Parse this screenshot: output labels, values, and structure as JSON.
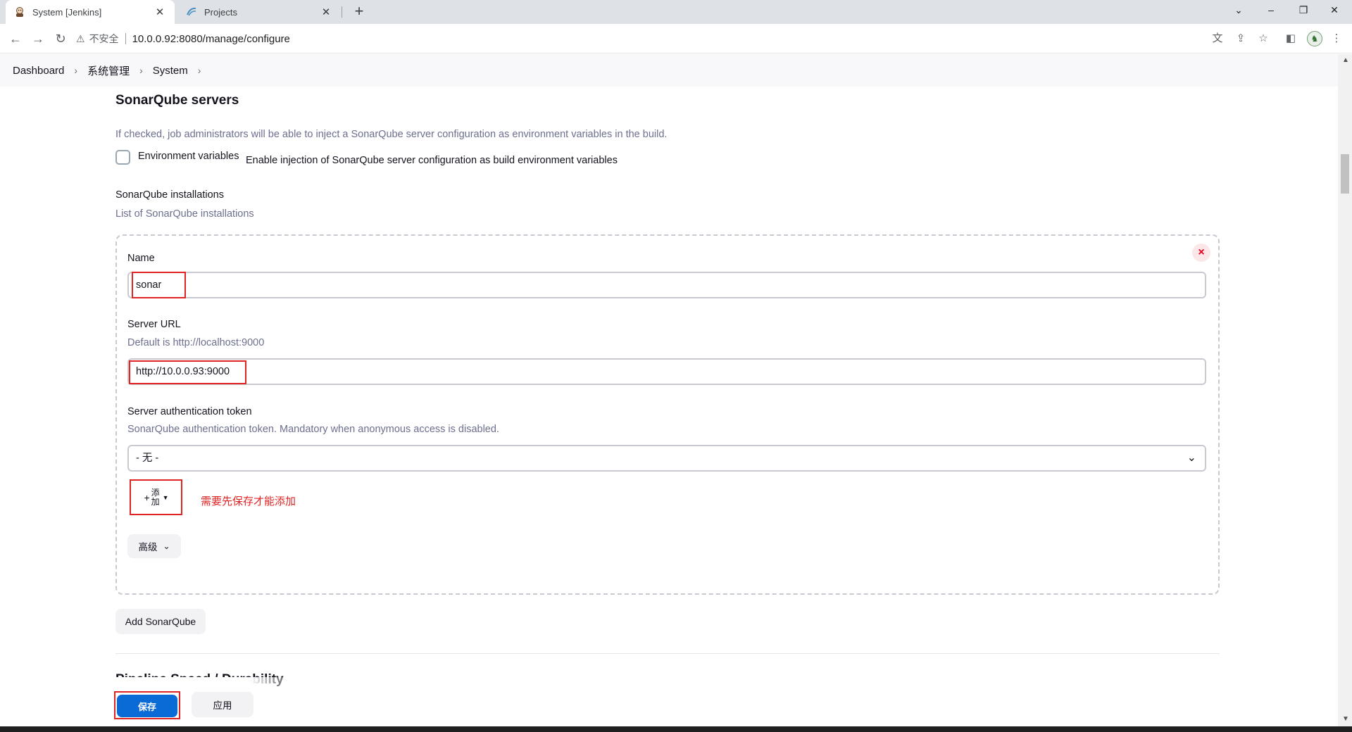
{
  "browser": {
    "tabs": [
      {
        "title": "System [Jenkins]",
        "active": true
      },
      {
        "title": "Projects",
        "active": false
      }
    ],
    "insecure_label": "不安全",
    "url": "10.0.0.92:8080/manage/configure"
  },
  "breadcrumb": [
    "Dashboard",
    "系统管理",
    "System"
  ],
  "section": {
    "title": "SonarQube servers",
    "env_help": "If checked, job administrators will be able to inject a SonarQube server configuration as environment variables in the build.",
    "env_label": "Environment variables",
    "env_desc": "Enable injection of SonarQube server configuration as build environment variables",
    "installations_label": "SonarQube installations",
    "installations_help": "List of SonarQube installations"
  },
  "installation": {
    "name_label": "Name",
    "name_value": "sonar",
    "url_label": "Server URL",
    "url_help": "Default is http://localhost:9000",
    "url_value": "http://10.0.0.93:9000",
    "token_label": "Server authentication token",
    "token_help": "SonarQube authentication token. Mandatory when anonymous access is disabled.",
    "token_value": "- 无 -",
    "add_label_top": "添",
    "add_label_bottom": "加",
    "annotation": "需要先保存才能添加",
    "advanced_label": "高级",
    "delete_symbol": "×"
  },
  "add_sonarqube_label": "Add SonarQube",
  "next_section_title": "Pipeline Speed / Durability",
  "footer": {
    "save_label": "保存",
    "apply_label": "应用"
  },
  "colors": {
    "primary": "#0b6bd6",
    "annotation_red": "#e02424",
    "help_text": "#6c6f8f"
  }
}
